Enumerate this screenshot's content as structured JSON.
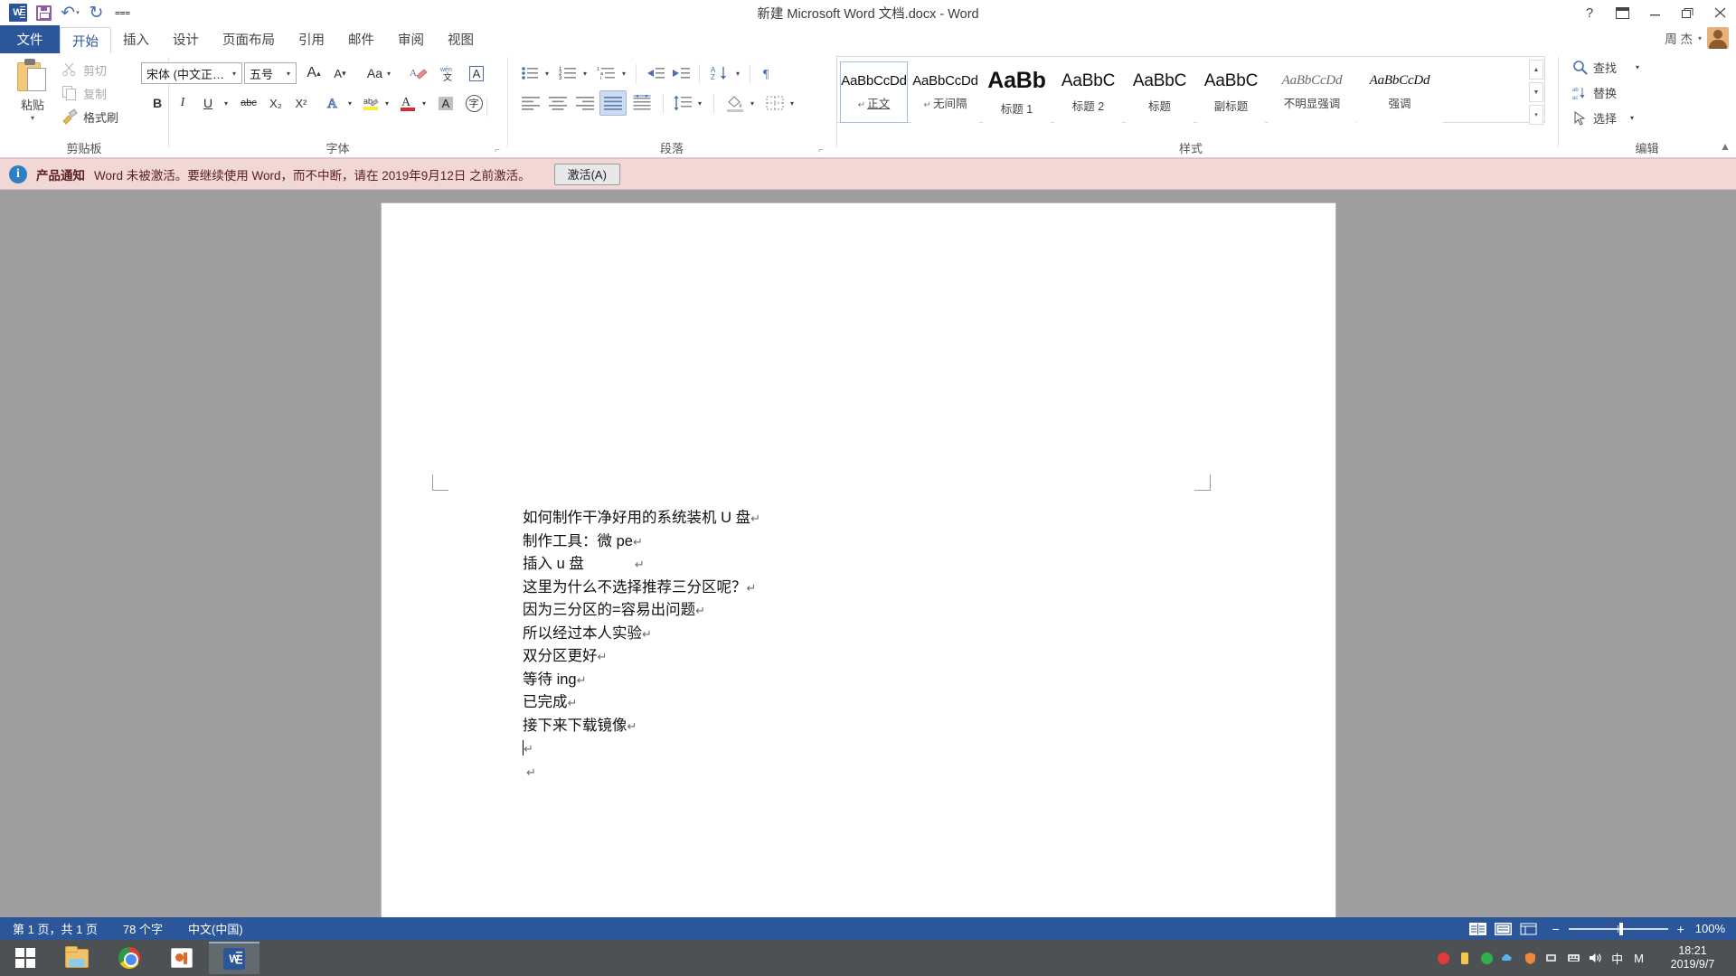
{
  "window": {
    "title": "新建 Microsoft Word 文档.docx - Word",
    "quick_access": [
      {
        "name": "word-logo",
        "label": "W"
      },
      {
        "name": "save",
        "label": "保存"
      },
      {
        "name": "undo",
        "label": "撤销"
      },
      {
        "name": "redo",
        "label": "重复"
      },
      {
        "name": "customize-qat",
        "label": "自定义快速访问工具栏"
      }
    ],
    "controls": {
      "help": "?",
      "ribbon_display": "功能区显示选项",
      "minimize": "最小化",
      "restore": "向下还原",
      "close": "关闭"
    }
  },
  "tabs": {
    "file": "文件",
    "items": [
      {
        "label": "开始",
        "active": true
      },
      {
        "label": "插入",
        "active": false
      },
      {
        "label": "设计",
        "active": false
      },
      {
        "label": "页面布局",
        "active": false
      },
      {
        "label": "引用",
        "active": false
      },
      {
        "label": "邮件",
        "active": false
      },
      {
        "label": "审阅",
        "active": false
      },
      {
        "label": "视图",
        "active": false
      }
    ]
  },
  "user": {
    "name": "周 杰",
    "caret": "▾"
  },
  "ribbon": {
    "groups": {
      "clipboard": {
        "label": "剪贴板",
        "paste": "粘贴",
        "paste_caret": "▾",
        "cut": "剪切",
        "copy": "复制",
        "format_painter": "格式刷"
      },
      "font": {
        "label": "字体",
        "font_name": "宋体 (中文正…",
        "font_size": "五号",
        "grow_font": "A",
        "shrink_font": "A",
        "change_case": "Aa",
        "clear_formatting": "清除所有格式",
        "phonetic_guide": "拼音指南",
        "character_border": "A",
        "bold": "B",
        "italic": "I",
        "underline": "U",
        "strikethrough": "abc",
        "subscript": "X₂",
        "superscript": "X²",
        "text_effects": "A",
        "highlight": "ab",
        "font_color": "A",
        "shading": "A",
        "enclose_characters": "字"
      },
      "paragraph": {
        "label": "段落",
        "bullets": "项目符号",
        "numbering": "编号",
        "multilevel": "多级列表",
        "decrease_indent": "减少缩进量",
        "increase_indent": "增加缩进量",
        "sort": "排序",
        "show_marks": "显示/隐藏编辑标记",
        "align_left": "左对齐",
        "align_center": "居中",
        "align_right": "右对齐",
        "justify": "两端对齐",
        "distributed": "分散对齐",
        "line_spacing": "行和段落间距",
        "shading_fill": "底纹",
        "borders": "边框"
      },
      "styles": {
        "label": "样式",
        "items": [
          {
            "sample": "AaBbCcDd",
            "name": "正文",
            "pilcrow": "↵",
            "active": true,
            "style": "normal"
          },
          {
            "sample": "AaBbCcDd",
            "name": "无间隔",
            "pilcrow": "↵",
            "active": false,
            "style": "normal"
          },
          {
            "sample": "AaBb",
            "name": "标题 1",
            "pilcrow": "",
            "active": false,
            "style": "h1"
          },
          {
            "sample": "AaBbC",
            "name": "标题 2",
            "pilcrow": "",
            "active": false,
            "style": "h2"
          },
          {
            "sample": "AaBbC",
            "name": "标题",
            "pilcrow": "",
            "active": false,
            "style": "title"
          },
          {
            "sample": "AaBbC",
            "name": "副标题",
            "pilcrow": "",
            "active": false,
            "style": "subtitle"
          },
          {
            "sample": "AaBbCcDd",
            "name": "不明显强调",
            "pilcrow": "",
            "active": false,
            "style": "subtle"
          },
          {
            "sample": "AaBbCcDd",
            "name": "强调",
            "pilcrow": "",
            "active": false,
            "style": "emph"
          }
        ],
        "scroll_up": "▲",
        "scroll_down": "▼",
        "more": "▾"
      },
      "editing": {
        "label": "编辑",
        "find": "查找",
        "find_caret": "▾",
        "replace": "替换",
        "select": "选择",
        "select_caret": "▾"
      }
    },
    "collapse": "▲"
  },
  "notification": {
    "icon": "i",
    "title": "产品通知",
    "message": "Word 未被激活。要继续使用 Word，而不中断，请在 2019年9月12日 之前激活。",
    "button": "激活(A)"
  },
  "document": {
    "lines": [
      {
        "text": "如何制作干净好用的系统装机 U 盘",
        "mark": "↵",
        "gap": false
      },
      {
        "text": "制作工具：微 pe",
        "mark": "↵",
        "gap": false
      },
      {
        "text": "插入 u 盘",
        "mark": "↵",
        "gap": true
      },
      {
        "text": "这里为什么不选择推荐三分区呢？",
        "mark": "↵",
        "gap": false
      },
      {
        "text": "因为三分区的=容易出问题",
        "mark": "↵",
        "gap": false
      },
      {
        "text": "所以经过本人实验",
        "mark": "↵",
        "gap": false
      },
      {
        "text": "双分区更好",
        "mark": "↵",
        "gap": false
      },
      {
        "text": "等待 ing",
        "mark": "↵",
        "gap": false
      },
      {
        "text": "已完成",
        "mark": "↵",
        "gap": false
      },
      {
        "text": "接下来下载镜像",
        "mark": "↵",
        "gap": false
      },
      {
        "text": "",
        "mark": "↵",
        "gap": false,
        "caret": true
      },
      {
        "text": "",
        "mark": "↵",
        "gap": false
      }
    ]
  },
  "statusbar": {
    "page": "第 1 页，共 1 页",
    "words": "78 个字",
    "language": "中文(中国)",
    "views": [
      "阅读视图",
      "页面视图",
      "Web 版式视图"
    ],
    "zoom_out": "−",
    "zoom_in": "+",
    "zoom_level": "100%"
  },
  "taskbar": {
    "start": "开始",
    "items": [
      {
        "name": "file-explorer",
        "active": false
      },
      {
        "name": "google-chrome",
        "active": false
      },
      {
        "name": "powerpoint",
        "active": false
      },
      {
        "name": "microsoft-word",
        "active": true
      }
    ],
    "tray": {
      "ime": "中",
      "ime2": "M",
      "time": "18:21",
      "date": "2019/9/7"
    }
  }
}
